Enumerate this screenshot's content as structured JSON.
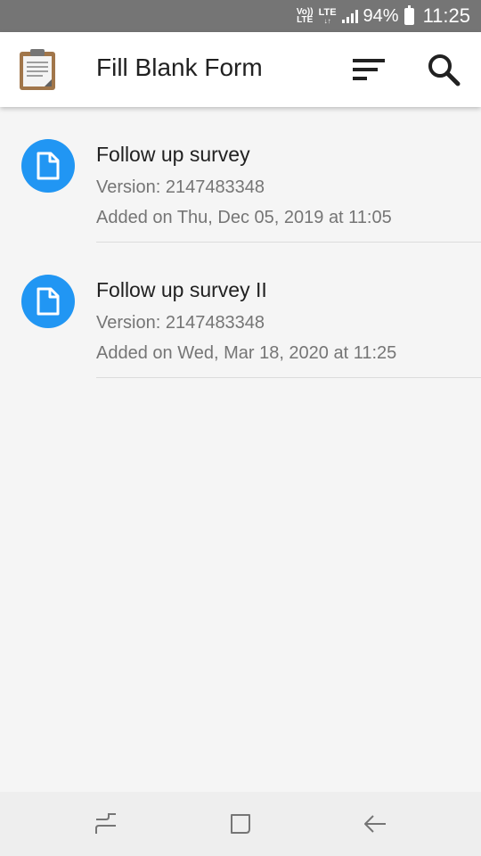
{
  "status_bar": {
    "volte_top": "Vo))",
    "volte_bottom": "LTE",
    "lte": "LTE",
    "battery": "94%",
    "time": "11:25"
  },
  "app_bar": {
    "title": "Fill Blank Form",
    "icons": [
      "clipboard-icon",
      "sort-icon",
      "search-icon"
    ]
  },
  "forms": [
    {
      "title": "Follow up survey",
      "version": "Version: 2147483348",
      "added": "Added on Thu, Dec 05, 2019 at 11:05"
    },
    {
      "title": "Follow up survey II",
      "version": "Version: 2147483348",
      "added": "Added on Wed, Mar 18, 2020 at 11:25"
    }
  ],
  "nav_bar": {
    "icons": [
      "recent-apps-icon",
      "home-icon",
      "back-icon"
    ]
  },
  "colors": {
    "status_bar": "#757575",
    "accent": "#2196f3",
    "background": "#f5f5f5"
  }
}
